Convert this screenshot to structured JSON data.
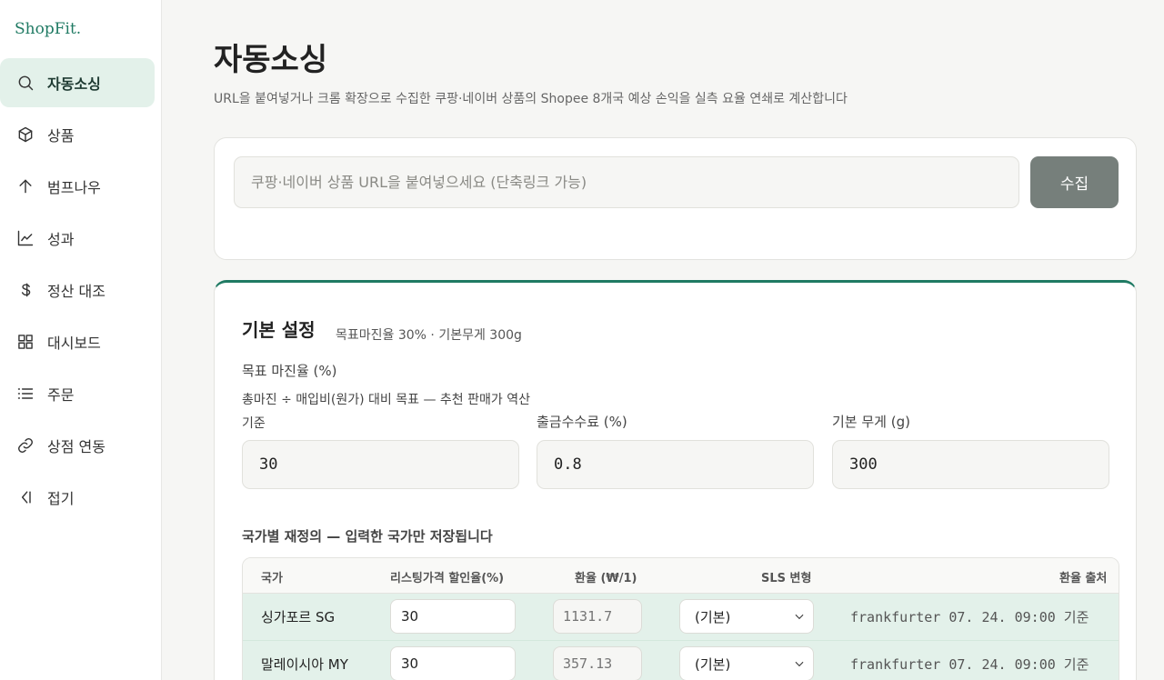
{
  "app": {
    "logo": "ShopFit."
  },
  "sidebar": {
    "items": [
      {
        "label": "자동소싱",
        "icon": "search-icon",
        "active": true
      },
      {
        "label": "상품",
        "icon": "box-icon"
      },
      {
        "label": "범프나우",
        "icon": "arrow-up-icon"
      },
      {
        "label": "성과",
        "icon": "line-chart-icon"
      },
      {
        "label": "정산 대조",
        "icon": "won-icon"
      },
      {
        "label": "대시보드",
        "icon": "grid-icon"
      },
      {
        "label": "주문",
        "icon": "list-icon"
      },
      {
        "label": "상점 연동",
        "icon": "link-icon"
      },
      {
        "label": "접기",
        "icon": "collapse-icon"
      }
    ]
  },
  "header": {
    "title": "자동소싱",
    "subtitle": "URL을 붙여넣거나 크롬 확장으로 수집한 쿠팡·네이버 상품의 Shopee 8개국 예상 손익을 실측 요율 연쇄로 계산합니다"
  },
  "url_card": {
    "placeholder": "쿠팡·네이버 상품 URL을 붙여넣으세요 (단축링크 가능)",
    "button": "수집"
  },
  "settings": {
    "title": "기본 설정",
    "meta": "목표마진율 30% · 기본무게 300g",
    "margin": {
      "label": "목표 마진율 (%)",
      "help": "총마진 ÷ 매입비(원가) 대비 목표 — 추천 판매가 역산 기준",
      "value": "30"
    },
    "fee": {
      "label": "출금수수료 (%)",
      "value": "0.8"
    },
    "weight": {
      "label": "기본 무게 (g)",
      "value": "300"
    },
    "override_title": "국가별 재정의 — 입력한 국가만 저장됩니다",
    "table": {
      "headers": [
        "국가",
        "리스팅가격 할인율(%)",
        "환율 (₩/1)",
        "SLS 변형",
        "환율 출처"
      ],
      "rows": [
        {
          "country": "싱가포르 SG",
          "discount": "30",
          "rate": "1131.7",
          "sls": "(기본)",
          "source": "frankfurter 07. 24. 09:00 기준"
        },
        {
          "country": "말레이시아 MY",
          "discount": "30",
          "rate": "357.13",
          "sls": "(기본)",
          "source": "frankfurter 07. 24. 09:00 기준"
        }
      ]
    }
  },
  "colors": {
    "accent": "#1f7a63",
    "active_bg": "#e3f1ea",
    "button": "#767f7b"
  }
}
